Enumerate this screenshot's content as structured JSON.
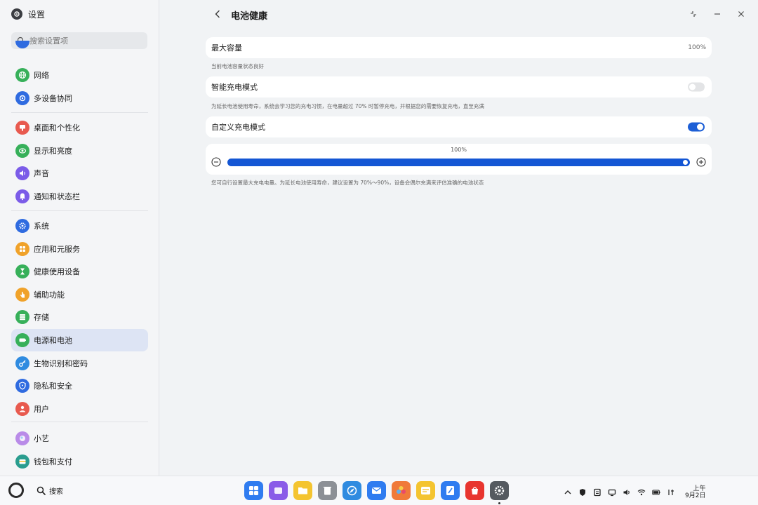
{
  "app": {
    "title": "设置",
    "search_placeholder": "搜索设置项"
  },
  "sidebar": {
    "items": [
      {
        "label": "网络",
        "icon": "network-icon",
        "color": "#37b05a"
      },
      {
        "label": "多设备协同",
        "icon": "multi-device-icon",
        "color": "#2f6be0"
      },
      {
        "label": "桌面和个性化",
        "icon": "desktop-personalize-icon",
        "color": "#e85a4f"
      },
      {
        "label": "显示和亮度",
        "icon": "display-brightness-icon",
        "color": "#37b05a"
      },
      {
        "label": "声音",
        "icon": "sound-icon",
        "color": "#7b5ce8"
      },
      {
        "label": "通知和状态栏",
        "icon": "notification-bell-icon",
        "color": "#7b5ce8"
      },
      {
        "label": "系统",
        "icon": "system-gear-icon",
        "color": "#2f6be0"
      },
      {
        "label": "应用和元服务",
        "icon": "apps-grid-icon",
        "color": "#f0a22a"
      },
      {
        "label": "健康使用设备",
        "icon": "hourglass-icon",
        "color": "#37b05a"
      },
      {
        "label": "辅助功能",
        "icon": "accessibility-hand-icon",
        "color": "#f0a22a"
      },
      {
        "label": "存储",
        "icon": "storage-icon",
        "color": "#37b05a"
      },
      {
        "label": "电源和电池",
        "icon": "battery-icon",
        "color": "#37b05a"
      },
      {
        "label": "生物识别和密码",
        "icon": "key-icon",
        "color": "#2f8be0"
      },
      {
        "label": "隐私和安全",
        "icon": "privacy-shield-icon",
        "color": "#2f6be0"
      },
      {
        "label": "用户",
        "icon": "user-icon",
        "color": "#e85a4f"
      },
      {
        "label": "小艺",
        "icon": "celia-assistant-icon",
        "color": "#b98be8"
      },
      {
        "label": "钱包和支付",
        "icon": "wallet-icon",
        "color": "#2a9d8f"
      }
    ],
    "active_label": "电源和电池"
  },
  "page": {
    "title": "电池健康",
    "max_capacity": {
      "label": "最大容量",
      "value": "100%",
      "hint": "当前电池容量状态良好"
    },
    "smart_charging": {
      "label": "智能充电模式",
      "enabled": false,
      "hint": "为延长电池使用寿命，系统会学习您的充电习惯，在电量超过 70% 时暂停充电，并根据您的需要恢复充电，直至充满"
    },
    "custom_charging": {
      "label": "自定义充电模式",
      "enabled": true,
      "hint": "您可自行设置最大充电电量。为延长电池使用寿命，建议设置为 70%～90%，设备会偶尔充满来评估准确的电池状态"
    },
    "charge_limit": {
      "value_label": "100%",
      "percent": 100
    }
  },
  "taskbar": {
    "search_label": "搜索",
    "dock": [
      {
        "name": "app-center-icon",
        "color": "#2f7cf0"
      },
      {
        "name": "multitask-icon",
        "color": "#8a5ce8"
      },
      {
        "name": "files-icon",
        "color": "#f4c430"
      },
      {
        "name": "trash-icon",
        "color": "#8c9096"
      },
      {
        "name": "browser-icon",
        "color": "#2f8be0"
      },
      {
        "name": "email-icon",
        "color": "#2f7cf0"
      },
      {
        "name": "gallery-icon",
        "color": "#f07a3a"
      },
      {
        "name": "notes-icon",
        "color": "#f4c430"
      },
      {
        "name": "docs-icon",
        "color": "#2f7cf0"
      },
      {
        "name": "app-gallery-icon",
        "color": "#e8352f"
      },
      {
        "name": "settings-icon",
        "color": "#555a60"
      }
    ],
    "clock": {
      "time": "上午",
      "date": "9月2日"
    }
  },
  "colors": {
    "accent": "#1d5fd6",
    "card": "#ffffff",
    "background": "#f1f3f5"
  }
}
